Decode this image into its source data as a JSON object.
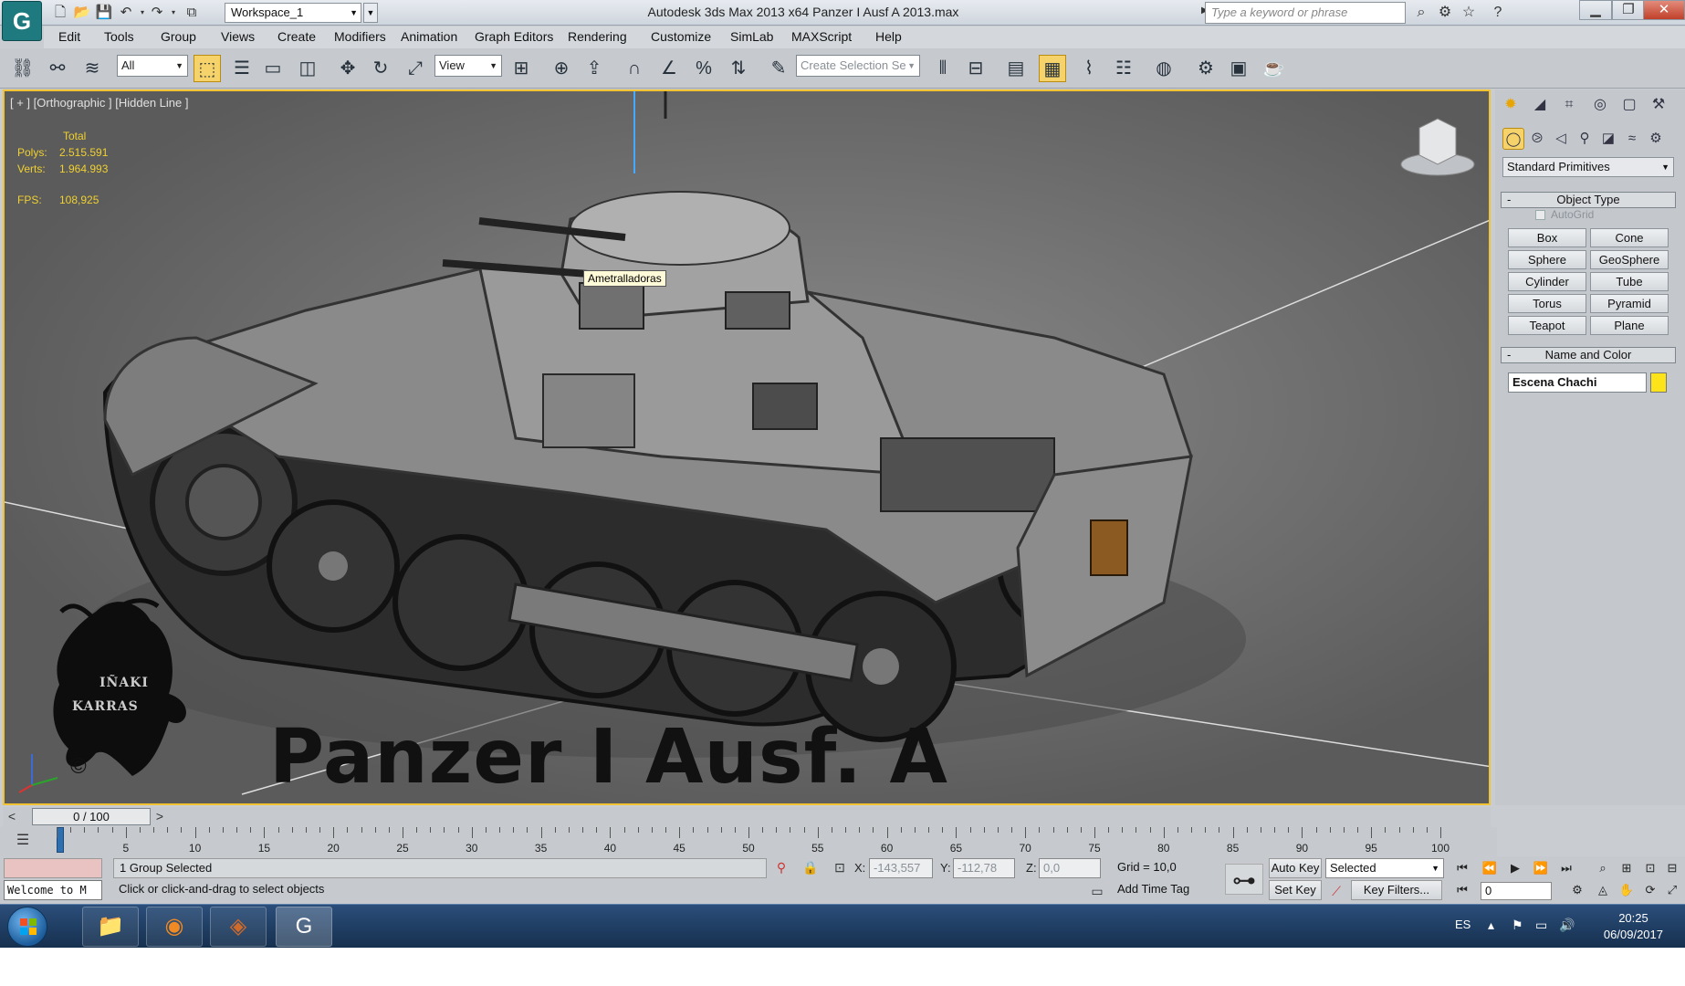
{
  "window": {
    "title": "Autodesk 3ds Max  2013 x64      Panzer I Ausf A 2013.max",
    "workspace": "Workspace_1",
    "search_placeholder": "Type a keyword or phrase"
  },
  "menu": [
    "Edit",
    "Tools",
    "Group",
    "Views",
    "Create",
    "Modifiers",
    "Animation",
    "Graph Editors",
    "Rendering",
    "Customize",
    "SimLab",
    "MAXScript",
    "Help"
  ],
  "toolbar": {
    "filter": "All",
    "ref_coord": "View",
    "selection_set_placeholder": "Create Selection Se"
  },
  "viewport": {
    "label": "[ + ] [Orthographic ] [Hidden Line ]",
    "stats_total": "Total",
    "polys_label": "Polys:",
    "polys_value": "2.515.591",
    "verts_label": "Verts:",
    "verts_value": "1.964.993",
    "fps_label": "FPS:",
    "fps_value": "108,925",
    "tooltip": "Ametralladoras",
    "title_text": "Panzer I Ausf. A",
    "logo_line1": "IÑAKI",
    "logo_line2": "KARRAS",
    "copyright": "©"
  },
  "command_panel": {
    "category": "Standard Primitives",
    "object_type_title": "Object Type",
    "autogrid": "AutoGrid",
    "primitives": [
      "Box",
      "Cone",
      "Sphere",
      "GeoSphere",
      "Cylinder",
      "Tube",
      "Torus",
      "Pyramid",
      "Teapot",
      "Plane"
    ],
    "name_color_title": "Name and Color",
    "object_name": "Escena Chachi",
    "color": "#fde31a"
  },
  "timeline": {
    "frame_display": "0 / 100",
    "ticks": [
      "5",
      "10",
      "15",
      "20",
      "25",
      "30",
      "35",
      "40",
      "45",
      "50",
      "55",
      "60",
      "65",
      "70",
      "75",
      "80",
      "85",
      "90",
      "95",
      "100"
    ]
  },
  "status": {
    "welcome": "Welcome to M",
    "selection": "1 Group Selected",
    "prompt": "Click or click-and-drag to select objects",
    "x_label": "X:",
    "x_value": "-143,557",
    "y_label": "Y:",
    "y_value": "-112,78",
    "z_label": "Z:",
    "z_value": "0,0",
    "grid": "Grid = 10,0",
    "add_time_tag": "Add Time Tag",
    "auto_key": "Auto Key",
    "set_key": "Set Key",
    "key_mode": "Selected",
    "key_filters": "Key Filters...",
    "current_frame": "0"
  },
  "taskbar": {
    "language": "ES",
    "time": "20:25",
    "date": "06/09/2017"
  }
}
